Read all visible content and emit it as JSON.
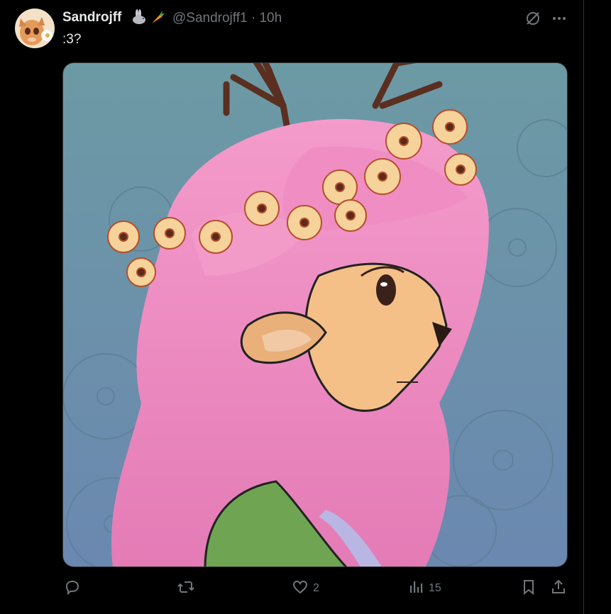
{
  "post": {
    "author_name": "Sandrojff",
    "name_emojis": [
      "rabbit-emoji",
      "carrot-emoji"
    ],
    "handle": "@Sandrojff1",
    "separator": "·",
    "time": "10h",
    "text": ":3?"
  },
  "actions": {
    "reply_count": "",
    "repost_count": "",
    "like_count": "2",
    "views_count": "15"
  },
  "icons": {
    "grok": "grok-icon",
    "more": "more-icon",
    "reply": "reply-icon",
    "repost": "repost-icon",
    "like": "heart-icon",
    "views": "views-icon",
    "bookmark": "bookmark-icon",
    "share": "share-icon"
  },
  "colors": {
    "background": "#000000",
    "text_primary": "#e7e9ea",
    "text_secondary": "#71767b",
    "border": "#2f3336",
    "illustration_bg": "#6e97a8",
    "hair": "#ef8fc4",
    "flower": "#f6d39a",
    "shirt": "#6fa552"
  }
}
